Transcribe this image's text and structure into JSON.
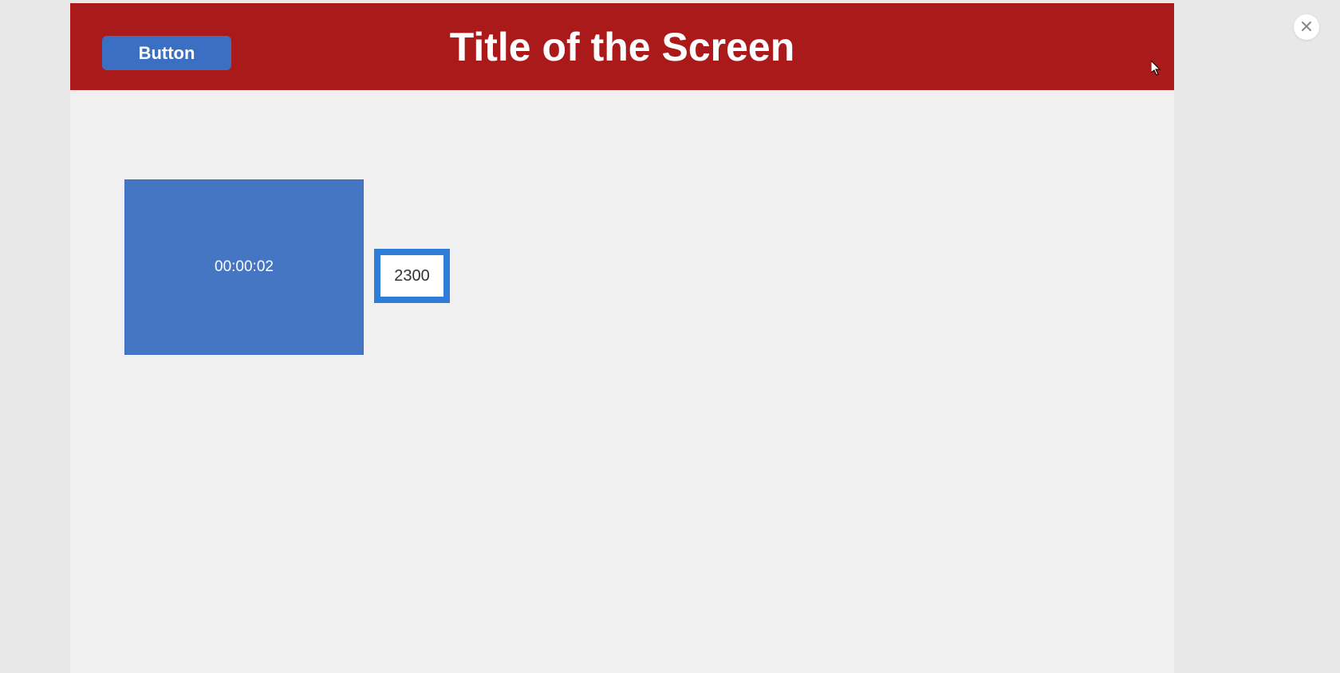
{
  "header": {
    "button_label": "Button",
    "title": "Title of the Screen"
  },
  "content": {
    "timer_value": "00:00:02",
    "number_value": "2300"
  },
  "colors": {
    "header_bg": "#aa1a1a",
    "button_bg": "#3a6fc4",
    "card_bg": "#4476c3",
    "box_border": "#2d7dd9"
  }
}
